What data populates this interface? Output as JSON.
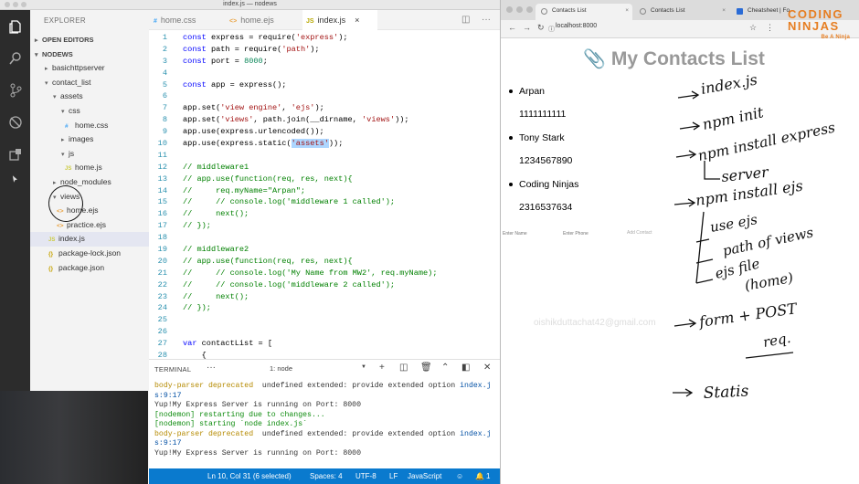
{
  "editor_window": {
    "title": "index.js — nodews"
  },
  "explorer": {
    "title": "EXPLORER",
    "sections": {
      "open_editors": "OPEN EDITORS",
      "project": "NODEWS"
    },
    "tree": [
      "basichttpserver",
      "contact_list",
      "assets",
      "css",
      "home.css",
      "images",
      "js",
      "home.js",
      "node_modules",
      "views",
      "home.ejs",
      "practice.ejs",
      "index.js",
      "package-lock.json",
      "package.json"
    ],
    "icons": {
      "css": "#",
      "js": "JS",
      "ejs": "<>",
      "json": "{}"
    }
  },
  "tabs": [
    {
      "label": "home.css",
      "icon": "#"
    },
    {
      "label": "home.ejs",
      "icon": "<>"
    },
    {
      "label": "index.js",
      "icon": "JS",
      "close": "×"
    }
  ],
  "code_lines": [
    [
      "1",
      "const express = require('express');"
    ],
    [
      "2",
      "const path = require('path');"
    ],
    [
      "3",
      "const port = 8000;"
    ],
    [
      "4",
      ""
    ],
    [
      "5",
      "const app = express();"
    ],
    [
      "6",
      ""
    ],
    [
      "7",
      "app.set('view engine', 'ejs');"
    ],
    [
      "8",
      "app.set('views', path.join(__dirname, 'views'));"
    ],
    [
      "9",
      "app.use(express.urlencoded());"
    ],
    [
      "10",
      "app.use(express.static('assets'));"
    ],
    [
      "11",
      ""
    ],
    [
      "12",
      "// middleware1"
    ],
    [
      "13",
      "// app.use(function(req, res, next){"
    ],
    [
      "14",
      "//     req.myName=\"Arpan\";"
    ],
    [
      "15",
      "//     // console.log('middleware 1 called');"
    ],
    [
      "16",
      "//     next();"
    ],
    [
      "17",
      "// });"
    ],
    [
      "18",
      ""
    ],
    [
      "19",
      "// middleware2"
    ],
    [
      "20",
      "// app.use(function(req, res, next){"
    ],
    [
      "21",
      "//     // console.log('My Name from MW2', req.myName);"
    ],
    [
      "22",
      "//     // console.log('middleware 2 called');"
    ],
    [
      "23",
      "//     next();"
    ],
    [
      "24",
      "// });"
    ],
    [
      "25",
      ""
    ],
    [
      "26",
      ""
    ],
    [
      "27",
      "var contactList = ["
    ],
    [
      "28",
      "    {"
    ]
  ],
  "terminal": {
    "title": "TERMINAL",
    "more": "···",
    "selector": "1: node",
    "lines": [
      {
        "parts": [
          [
            "y",
            "body-parser "
          ],
          [
            "y",
            "deprecated"
          ],
          [
            "",
            "  undefined extended: provide extended option "
          ],
          [
            "b",
            "index.j"
          ]
        ]
      },
      {
        "parts": [
          [
            "b",
            "s:9:17"
          ]
        ]
      },
      {
        "parts": [
          [
            "",
            "Yup!My Express Server is running on Port: 8000"
          ]
        ]
      },
      {
        "parts": [
          [
            "g",
            "[nodemon] restarting due to changes..."
          ]
        ]
      },
      {
        "parts": [
          [
            "g",
            "[nodemon] starting `node index.js`"
          ]
        ]
      },
      {
        "parts": [
          [
            "y",
            "body-parser "
          ],
          [
            "y",
            "deprecated"
          ],
          [
            "",
            "  undefined extended: provide extended option "
          ],
          [
            "b",
            "index.j"
          ]
        ]
      },
      {
        "parts": [
          [
            "b",
            "s:9:17"
          ]
        ]
      },
      {
        "parts": [
          [
            "",
            "Yup!My Express Server is running on Port: 8000"
          ]
        ]
      }
    ]
  },
  "statusbar": {
    "position": "Ln 10, Col 31 (6 selected)",
    "spaces": "Spaces: 4",
    "encoding": "UTF-8",
    "eol": "LF",
    "language": "JavaScript",
    "bell": "1"
  },
  "browser": {
    "tabs": [
      {
        "label": "Contacts List"
      },
      {
        "label": "Contacts List"
      },
      {
        "label": "Cheatsheet | Fo"
      }
    ],
    "url": "localhost:8000",
    "logo_line1": "CODING",
    "logo_line2": "NINJAS",
    "logo_tag": "Be A Ninja",
    "page_title": "My Contacts List",
    "contacts": [
      {
        "name": "Arpan",
        "phone": "1111111111"
      },
      {
        "name": "Tony Stark",
        "phone": "1234567890"
      },
      {
        "name": "Coding Ninjas",
        "phone": "2316537634"
      }
    ],
    "form": {
      "name_placeholder": "Enter Name",
      "phone_placeholder": "Enter Phone",
      "submit": "Add Contact"
    },
    "watermark": "oishikduttachat42@gmail.com"
  },
  "handwriting": {
    "notes": [
      "index.js",
      "npm init",
      "npm install express",
      "server",
      "npm install ejs",
      "use ejs",
      "path of views",
      "ejs file",
      "(home)",
      "form + POST",
      "req.",
      "Statis"
    ]
  }
}
